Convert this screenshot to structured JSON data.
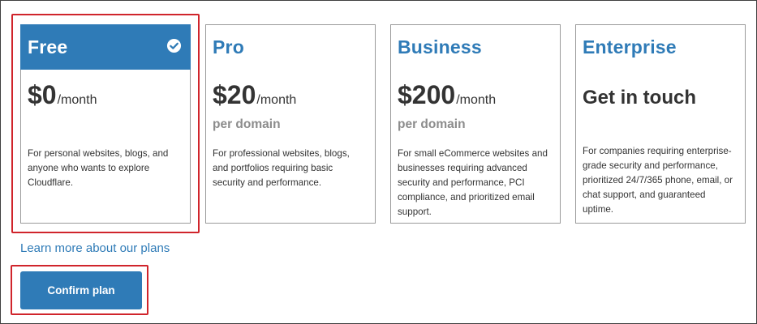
{
  "plans": [
    {
      "name": "Free",
      "price": "$0",
      "unit": "/month",
      "description": "For personal websites, blogs, and anyone who wants to explore Cloudflare.",
      "selected": true
    },
    {
      "name": "Pro",
      "price": "$20",
      "unit": "/month",
      "sub": "per domain",
      "description": "For professional websites, blogs, and portfolios requiring basic security and performance."
    },
    {
      "name": "Business",
      "price": "$200",
      "unit": "/month",
      "sub": "per domain",
      "description": "For small eCommerce websites and businesses requiring advanced security and performance, PCI compliance, and prioritized email support."
    },
    {
      "name": "Enterprise",
      "price_text": "Get in touch",
      "description": "For companies requiring enterprise-grade security and performance, prioritized 24/7/365 phone, email, or chat support, and guaranteed uptime."
    }
  ],
  "learn_more": "Learn more about our plans",
  "confirm_button": "Confirm plan",
  "selected_icon": "check-circle-icon",
  "colors": {
    "accent": "#2f7bb7",
    "highlight": "#d0242b",
    "muted": "#8c8c8c"
  }
}
